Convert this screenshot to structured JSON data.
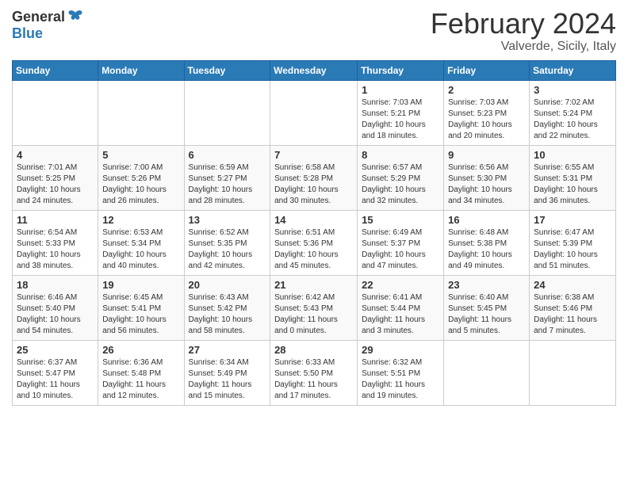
{
  "header": {
    "logo_general": "General",
    "logo_blue": "Blue",
    "month_title": "February 2024",
    "location": "Valverde, Sicily, Italy"
  },
  "weekdays": [
    "Sunday",
    "Monday",
    "Tuesday",
    "Wednesday",
    "Thursday",
    "Friday",
    "Saturday"
  ],
  "weeks": [
    [
      {
        "day": "",
        "info": ""
      },
      {
        "day": "",
        "info": ""
      },
      {
        "day": "",
        "info": ""
      },
      {
        "day": "",
        "info": ""
      },
      {
        "day": "1",
        "info": "Sunrise: 7:03 AM\nSunset: 5:21 PM\nDaylight: 10 hours\nand 18 minutes."
      },
      {
        "day": "2",
        "info": "Sunrise: 7:03 AM\nSunset: 5:23 PM\nDaylight: 10 hours\nand 20 minutes."
      },
      {
        "day": "3",
        "info": "Sunrise: 7:02 AM\nSunset: 5:24 PM\nDaylight: 10 hours\nand 22 minutes."
      }
    ],
    [
      {
        "day": "4",
        "info": "Sunrise: 7:01 AM\nSunset: 5:25 PM\nDaylight: 10 hours\nand 24 minutes."
      },
      {
        "day": "5",
        "info": "Sunrise: 7:00 AM\nSunset: 5:26 PM\nDaylight: 10 hours\nand 26 minutes."
      },
      {
        "day": "6",
        "info": "Sunrise: 6:59 AM\nSunset: 5:27 PM\nDaylight: 10 hours\nand 28 minutes."
      },
      {
        "day": "7",
        "info": "Sunrise: 6:58 AM\nSunset: 5:28 PM\nDaylight: 10 hours\nand 30 minutes."
      },
      {
        "day": "8",
        "info": "Sunrise: 6:57 AM\nSunset: 5:29 PM\nDaylight: 10 hours\nand 32 minutes."
      },
      {
        "day": "9",
        "info": "Sunrise: 6:56 AM\nSunset: 5:30 PM\nDaylight: 10 hours\nand 34 minutes."
      },
      {
        "day": "10",
        "info": "Sunrise: 6:55 AM\nSunset: 5:31 PM\nDaylight: 10 hours\nand 36 minutes."
      }
    ],
    [
      {
        "day": "11",
        "info": "Sunrise: 6:54 AM\nSunset: 5:33 PM\nDaylight: 10 hours\nand 38 minutes."
      },
      {
        "day": "12",
        "info": "Sunrise: 6:53 AM\nSunset: 5:34 PM\nDaylight: 10 hours\nand 40 minutes."
      },
      {
        "day": "13",
        "info": "Sunrise: 6:52 AM\nSunset: 5:35 PM\nDaylight: 10 hours\nand 42 minutes."
      },
      {
        "day": "14",
        "info": "Sunrise: 6:51 AM\nSunset: 5:36 PM\nDaylight: 10 hours\nand 45 minutes."
      },
      {
        "day": "15",
        "info": "Sunrise: 6:49 AM\nSunset: 5:37 PM\nDaylight: 10 hours\nand 47 minutes."
      },
      {
        "day": "16",
        "info": "Sunrise: 6:48 AM\nSunset: 5:38 PM\nDaylight: 10 hours\nand 49 minutes."
      },
      {
        "day": "17",
        "info": "Sunrise: 6:47 AM\nSunset: 5:39 PM\nDaylight: 10 hours\nand 51 minutes."
      }
    ],
    [
      {
        "day": "18",
        "info": "Sunrise: 6:46 AM\nSunset: 5:40 PM\nDaylight: 10 hours\nand 54 minutes."
      },
      {
        "day": "19",
        "info": "Sunrise: 6:45 AM\nSunset: 5:41 PM\nDaylight: 10 hours\nand 56 minutes."
      },
      {
        "day": "20",
        "info": "Sunrise: 6:43 AM\nSunset: 5:42 PM\nDaylight: 10 hours\nand 58 minutes."
      },
      {
        "day": "21",
        "info": "Sunrise: 6:42 AM\nSunset: 5:43 PM\nDaylight: 11 hours\nand 0 minutes."
      },
      {
        "day": "22",
        "info": "Sunrise: 6:41 AM\nSunset: 5:44 PM\nDaylight: 11 hours\nand 3 minutes."
      },
      {
        "day": "23",
        "info": "Sunrise: 6:40 AM\nSunset: 5:45 PM\nDaylight: 11 hours\nand 5 minutes."
      },
      {
        "day": "24",
        "info": "Sunrise: 6:38 AM\nSunset: 5:46 PM\nDaylight: 11 hours\nand 7 minutes."
      }
    ],
    [
      {
        "day": "25",
        "info": "Sunrise: 6:37 AM\nSunset: 5:47 PM\nDaylight: 11 hours\nand 10 minutes."
      },
      {
        "day": "26",
        "info": "Sunrise: 6:36 AM\nSunset: 5:48 PM\nDaylight: 11 hours\nand 12 minutes."
      },
      {
        "day": "27",
        "info": "Sunrise: 6:34 AM\nSunset: 5:49 PM\nDaylight: 11 hours\nand 15 minutes."
      },
      {
        "day": "28",
        "info": "Sunrise: 6:33 AM\nSunset: 5:50 PM\nDaylight: 11 hours\nand 17 minutes."
      },
      {
        "day": "29",
        "info": "Sunrise: 6:32 AM\nSunset: 5:51 PM\nDaylight: 11 hours\nand 19 minutes."
      },
      {
        "day": "",
        "info": ""
      },
      {
        "day": "",
        "info": ""
      }
    ]
  ]
}
